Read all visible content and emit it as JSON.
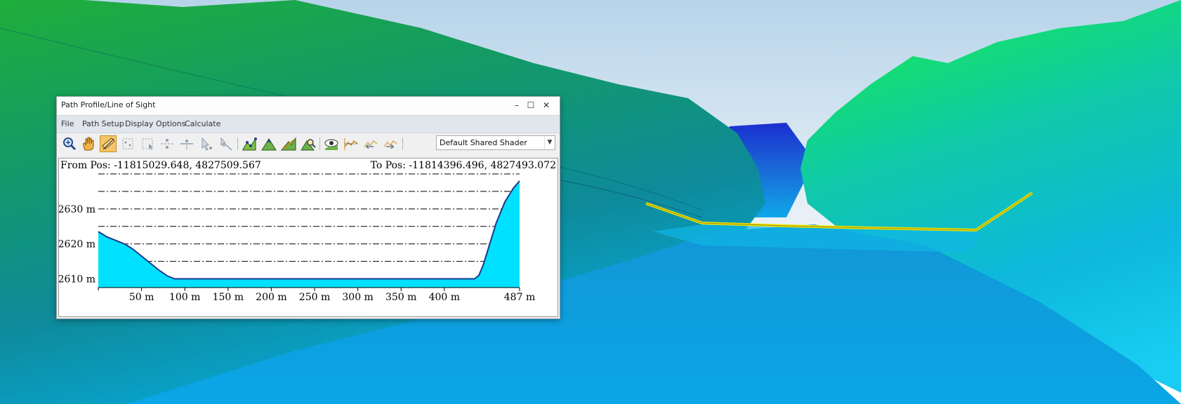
{
  "window": {
    "title": "Path Profile/Line of Sight",
    "controls": {
      "minimize": "–",
      "maximize": "☐",
      "close": "✕"
    }
  },
  "menu": [
    "File",
    "Path Setup",
    "Display Options",
    "Calculate"
  ],
  "toolbar": {
    "tools": [
      "zoom-tool-icon",
      "pan-hand-icon",
      "measure-ruler-icon",
      "select-points-icon",
      "select-area-icon",
      "line-points-icon",
      "line-break-icon",
      "pointer-select-icon",
      "pointer-line-icon",
      "profile-path-icon",
      "terrain-peak-icon",
      "terrain-slope-icon",
      "terrain-search-icon",
      "line-of-sight-eye-icon",
      "profile-edit-icon",
      "move-left-icon",
      "move-right-icon"
    ],
    "shader_value": "Default Shared Shader"
  },
  "profile": {
    "from_pos": "From Pos: -11815029.648, 4827509.567",
    "to_pos": "To Pos: -11814396.496, 4827493.072",
    "fill_color": "#00e0ff",
    "edge_color": "#1a3a8a"
  },
  "chart_data": {
    "type": "area",
    "title": "",
    "xlabel": "",
    "ylabel": "",
    "x_tick_labels": [
      "50 m",
      "100 m",
      "150 m",
      "200 m",
      "250 m",
      "300 m",
      "350 m",
      "400 m",
      "487 m"
    ],
    "x_ticks": [
      50,
      100,
      150,
      200,
      250,
      300,
      350,
      400,
      487
    ],
    "y_tick_labels": [
      "2610 m",
      "2620 m",
      "2630 m"
    ],
    "y_ticks": [
      2610,
      2620,
      2630
    ],
    "xlim": [
      0,
      487
    ],
    "ylim": [
      2607.5,
      2640
    ],
    "grid": true,
    "series": [
      {
        "x": [
          0,
          10,
          20,
          30,
          40,
          50,
          60,
          70,
          80,
          88,
          100,
          150,
          200,
          250,
          300,
          350,
          400,
          435,
          440,
          445,
          450,
          455,
          460,
          465,
          470,
          475,
          480,
          487
        ],
        "values": [
          2623.5,
          2622,
          2621,
          2620,
          2618.5,
          2616.5,
          2614.5,
          2612.5,
          2610.8,
          2610,
          2610,
          2610,
          2610,
          2610,
          2610,
          2610,
          2610,
          2610,
          2611,
          2614,
          2618,
          2622,
          2626,
          2629,
          2632,
          2634,
          2636,
          2638
        ]
      }
    ]
  },
  "scene": {
    "path_line_color": "#f2e600"
  }
}
